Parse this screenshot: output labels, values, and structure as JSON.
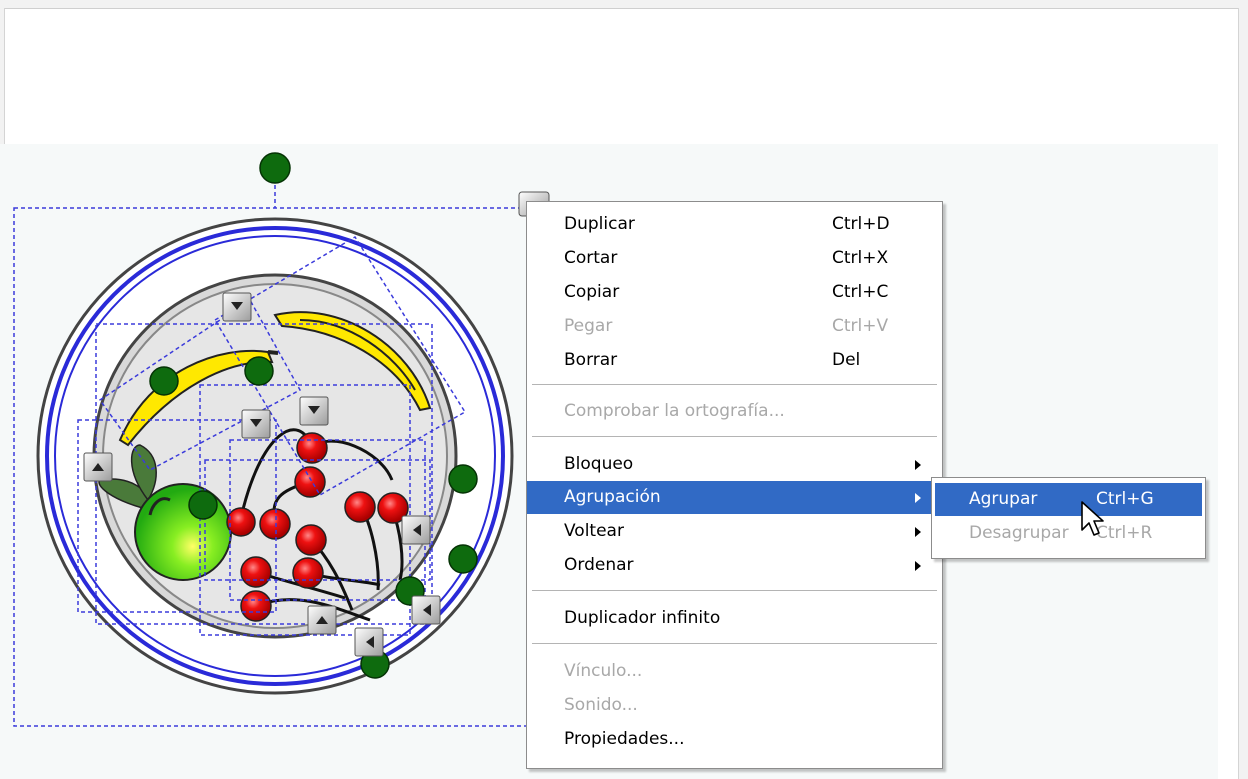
{
  "context_menu": {
    "items": [
      {
        "label": "Duplicar",
        "shortcut": "Ctrl+D"
      },
      {
        "label": "Cortar",
        "shortcut": "Ctrl+X"
      },
      {
        "label": "Copiar",
        "shortcut": "Ctrl+C"
      },
      {
        "label": "Pegar",
        "shortcut": "Ctrl+V",
        "disabled": true
      },
      {
        "label": "Borrar",
        "shortcut": "Del"
      },
      {
        "label": "Comprobar la ortografía...",
        "disabled": true
      },
      {
        "label": "Bloqueo"
      },
      {
        "label": "Agrupación",
        "highlighted": true
      },
      {
        "label": "Voltear"
      },
      {
        "label": "Ordenar"
      },
      {
        "label": "Duplicador infinito"
      },
      {
        "label": "Vínculo...",
        "disabled": true
      },
      {
        "label": "Sonido...",
        "disabled": true
      },
      {
        "label": "Propiedades..."
      }
    ]
  },
  "submenu": {
    "items": [
      {
        "label": "Agrupar",
        "shortcut": "Ctrl+G",
        "highlighted": true
      },
      {
        "label": "Desagrupar",
        "shortcut": "Ctrl+R",
        "disabled": true
      }
    ]
  },
  "colors": {
    "highlight": "#316ac5",
    "selection_outline": "#3b3bdb",
    "handle_green": "#0e6b0e",
    "plate_blue": "#2a2ad8",
    "banana_yellow": "#ffe800",
    "cherry_red": "#ee1111",
    "apple_green": "#33cc22"
  }
}
